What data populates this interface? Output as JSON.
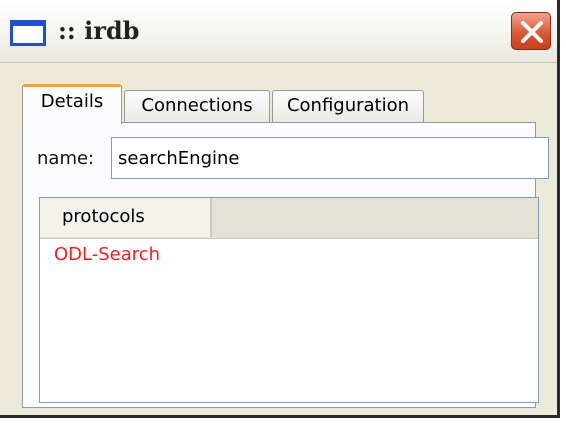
{
  "window": {
    "title": ":: irdb"
  },
  "icons": {
    "app": "window-icon",
    "close": "close-icon"
  },
  "tabs": [
    {
      "label": "Details",
      "active": true
    },
    {
      "label": "Connections",
      "active": false
    },
    {
      "label": "Configuration",
      "active": false
    }
  ],
  "details": {
    "name_label": "name:",
    "name_value": "searchEngine",
    "list": {
      "columns": [
        "protocols",
        ""
      ],
      "rows": [
        "ODL-Search"
      ]
    }
  },
  "colors": {
    "active_tab_accent": "#ffa020",
    "row_text": "#ff1a1a",
    "close_button": "#d9542f"
  }
}
